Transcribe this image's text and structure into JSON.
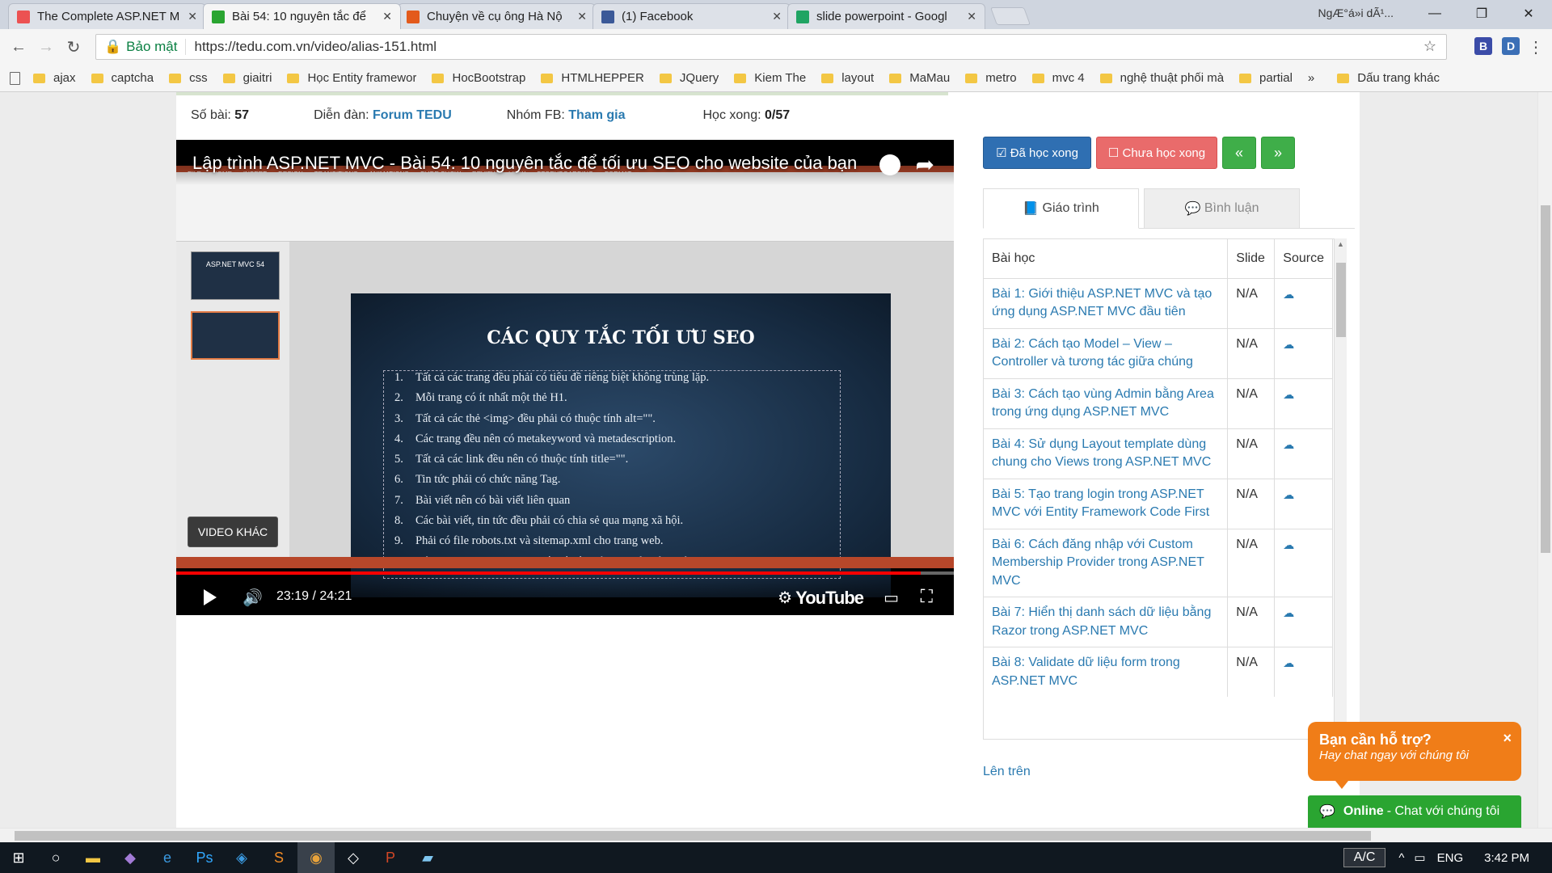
{
  "browser": {
    "tabs": [
      {
        "title": "The Complete ASP.NET M",
        "favicon": "udemy-icon",
        "color": "#ec5252",
        "active": false
      },
      {
        "title": "Bài 54: 10 nguyên tắc để",
        "favicon": "tedu-icon",
        "color": "#2aa531",
        "active": true
      },
      {
        "title": "Chuyện về cụ ông Hà Nộ",
        "favicon": "news-icon",
        "color": "#e35a1c",
        "active": false
      },
      {
        "title": "(1) Facebook",
        "favicon": "facebook-icon",
        "color": "#3b5998",
        "active": false
      },
      {
        "title": "slide powerpoint - Googl",
        "favicon": "google-drive-icon",
        "color": "#1fa463",
        "active": false
      }
    ],
    "user": "NgÆ°á»i dÃ¹...",
    "secure_label": "Bảo mật",
    "url": "https://tedu.com.vn/video/alias-151.html",
    "extensions": [
      "B",
      "D"
    ],
    "bookmarks": [
      "ajax",
      "captcha",
      "css",
      "giaitri",
      "Học Entity framewor",
      "HocBootstrap",
      "HTMLHEPPER",
      "JQuery",
      "Kiem The",
      "layout",
      "MaMau",
      "metro",
      "mvc 4",
      "nghệ thuật phối mà",
      "partial"
    ],
    "bookmarks_more": "»",
    "other_bookmarks": "Dấu trang khác"
  },
  "stats": {
    "lessons_label": "Số bài:",
    "lessons_value": "57",
    "forum_label": "Diễn đàn:",
    "forum_link": "Forum TEDU",
    "group_label": "Nhóm FB:",
    "group_link": "Tham gia",
    "done_label": "Học xong:",
    "done_value": "0/57"
  },
  "video": {
    "title": "Lập trình ASP.NET MVC - Bài 54: 10 nguyên tắc để tối ưu SEO cho website của bạn",
    "slide_title": "CÁC QUY TẮC TỐI ƯU SEO",
    "slide_items": [
      "Tất cả các trang đều phải có tiêu đề riêng biệt không trùng lặp.",
      "Mỗi trang có ít nhất một thẻ H1.",
      "Tất cả các thẻ <img> đều phải có thuộc tính alt=\"\".",
      "Các trang đều nên có metakeyword và metadescription.",
      "Tất cả các link đều nên có thuộc tính title=\"\".",
      "Tin tức phải có chức năng Tag.",
      "Bài viết nên có bài viết liên quan",
      "Các bài viết, tin tức đều phải có chia sẻ qua mạng xã hội.",
      "Phải có file robots.txt và sitemap.xml cho trang web.",
      "Nội dung trang chủ phải thiết kế để thường xuyên cập nhật."
    ],
    "thumb1_text": "ASP.NET MVC 54",
    "other_videos": "VIDEO KHÁC",
    "time": "23:19 / 24:21",
    "progress": 0.957,
    "brand": "YouTube"
  },
  "actions": {
    "done": "Đã học xong",
    "not_done": "Chưa học xong",
    "prev": "«",
    "next": "»"
  },
  "panel_tabs": {
    "syllabus": "Giáo trình",
    "comments": "Bình luận"
  },
  "lessons_table": {
    "headers": [
      "Bài học",
      "Slide",
      "Source"
    ],
    "rows": [
      {
        "title": "Bài 1: Giới thiệu ASP.NET MVC và tạo ứng dụng ASP.NET MVC đầu tiên",
        "slide": "N/A"
      },
      {
        "title": "Bài 2: Cách tạo Model – View – Controller và tương tác giữa chúng",
        "slide": "N/A"
      },
      {
        "title": "Bài 3: Cách tạo vùng Admin bằng Area trong ứng dụng ASP.NET MVC",
        "slide": "N/A"
      },
      {
        "title": "Bài 4: Sử dụng Layout template dùng chung cho Views trong ASP.NET MVC",
        "slide": "N/A"
      },
      {
        "title": "Bài 5: Tạo trang login trong ASP.NET MVC với Entity Framework Code First",
        "slide": "N/A"
      },
      {
        "title": "Bài 6: Cách đăng nhập với Custom Membership Provider trong ASP.NET MVC",
        "slide": "N/A"
      },
      {
        "title": "Bài 7: Hiển thị danh sách dữ liệu bằng Razor trong ASP.NET MVC",
        "slide": "N/A"
      },
      {
        "title": "Bài 8: Validate dữ liệu form trong ASP.NET MVC",
        "slide": "N/A"
      }
    ]
  },
  "back_to_top": "Lên trên",
  "chat": {
    "title": "Bạn cần hỗ trợ?",
    "subtitle": "Hay chat ngay với chúng tôi",
    "close": "×",
    "online_label": "Online",
    "online_text": "- Chat với chúng tôi"
  },
  "taskbar": {
    "ac": "A/C",
    "lang": "ENG",
    "time": "3:42 PM"
  }
}
